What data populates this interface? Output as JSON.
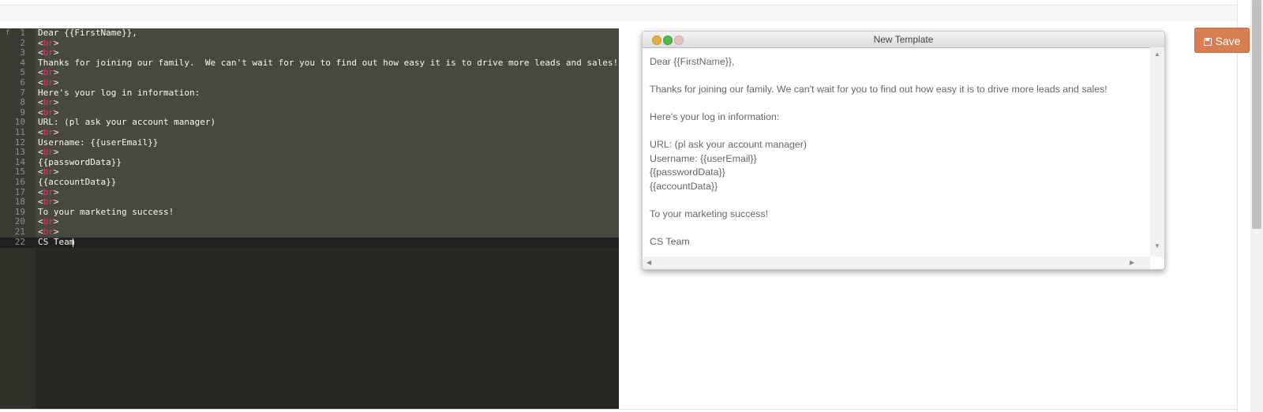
{
  "editor": {
    "fold_marker": "f",
    "lines": [
      {
        "num": "1",
        "text": "Dear {{FirstName}},"
      },
      {
        "num": "2",
        "text": "<br>"
      },
      {
        "num": "3",
        "text": "<br>"
      },
      {
        "num": "4",
        "text": "Thanks for joining our family.  We can't wait for you to find out how easy it is to drive more leads and sales!"
      },
      {
        "num": "5",
        "text": "<br>"
      },
      {
        "num": "6",
        "text": "<br>"
      },
      {
        "num": "7",
        "text": "Here's your log in information:"
      },
      {
        "num": "8",
        "text": "<br>"
      },
      {
        "num": "9",
        "text": "<br>"
      },
      {
        "num": "10",
        "text": "URL: (pl ask your account manager)"
      },
      {
        "num": "11",
        "text": "<br>"
      },
      {
        "num": "12",
        "text": "Username: {{userEmail}}"
      },
      {
        "num": "13",
        "text": "<br>"
      },
      {
        "num": "14",
        "text": "{{passwordData}}"
      },
      {
        "num": "15",
        "text": "<br>"
      },
      {
        "num": "16",
        "text": "{{accountData}}"
      },
      {
        "num": "17",
        "text": "<br>"
      },
      {
        "num": "18",
        "text": "<br>"
      },
      {
        "num": "19",
        "text": "To your marketing success!"
      },
      {
        "num": "20",
        "text": "<br>"
      },
      {
        "num": "21",
        "text": "<br>"
      },
      {
        "num": "22",
        "text": "CS Team"
      }
    ]
  },
  "preview": {
    "title": "New Template",
    "paragraphs": [
      "Dear {{FirstName}},",
      "",
      "Thanks for joining our family. We can't wait for you to find out how easy it is to drive more leads and sales!",
      "",
      "Here's your log in information:",
      "",
      "URL: (pl ask your account manager)",
      "Username: {{userEmail}}",
      "{{passwordData}}",
      "{{accountData}}",
      "",
      "To your marketing success!",
      "",
      "CS Team"
    ]
  },
  "toolbar": {
    "save_label": "Save",
    "save_icon": "floppy-disk-icon"
  },
  "colors": {
    "editor_bg": "#272822",
    "selection": "#49483e",
    "tag": "#f92672",
    "save_button": "#d87e55"
  }
}
